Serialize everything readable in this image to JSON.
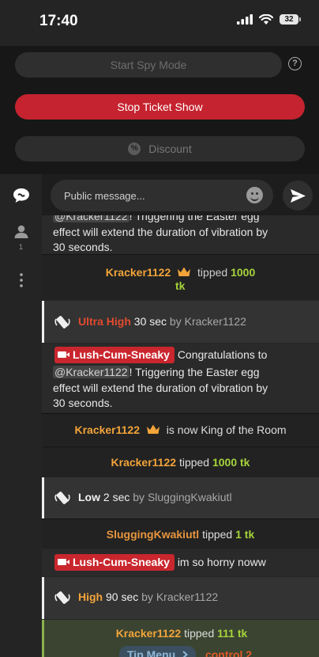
{
  "status_bar": {
    "time": "17:40",
    "battery": "32"
  },
  "controls": {
    "spy_mode": "Start Spy Mode",
    "help": "?",
    "stop_ticket_show": "Stop Ticket Show",
    "discount_icon": "%",
    "discount": "Discount"
  },
  "sidebar": {
    "user_count": "1"
  },
  "composer": {
    "placeholder": "Public message..."
  },
  "chat": {
    "m0": {
      "l1_user": "@Kracker1122",
      "l1_rest": "! Triggering the Easter egg",
      "l2": "effect will extend the duration of vibration by",
      "l3": "30 seconds."
    },
    "m1": {
      "user": "Kracker1122",
      "verb": "tipped",
      "amount": "1000",
      "unit": "tk"
    },
    "m2": {
      "level": "Ultra High",
      "duration": "30 sec",
      "by": "by",
      "user": "Kracker1122"
    },
    "m3": {
      "badge": "Lush-Cum-Sneaky",
      "l1": "Congratulations to",
      "mention": "@Kracker1122",
      "l2_rest": "! Triggering the Easter egg",
      "l3": "effect will extend the duration of vibration by",
      "l4": "30 seconds."
    },
    "m4": {
      "user": "Kracker1122",
      "text": "is now King of the Room"
    },
    "m5": {
      "user": "Kracker1122",
      "verb": "tipped",
      "amount": "1000 tk"
    },
    "m6": {
      "level": "Low",
      "duration": "2 sec",
      "by": "by",
      "user": "SluggingKwakiutl"
    },
    "m7": {
      "user": "SluggingKwakiutl",
      "verb": "tipped",
      "amount": "1 tk"
    },
    "m8": {
      "badge": "Lush-Cum-Sneaky",
      "text": "im so horny noww"
    },
    "m9": {
      "level": "High",
      "duration": "90 sec",
      "by": "by",
      "user": "Kracker1122"
    },
    "m10": {
      "user": "Kracker1122",
      "verb": "tipped",
      "amount": "111 tk",
      "tip_menu": "Tip Menu",
      "control": "control 2"
    }
  }
}
